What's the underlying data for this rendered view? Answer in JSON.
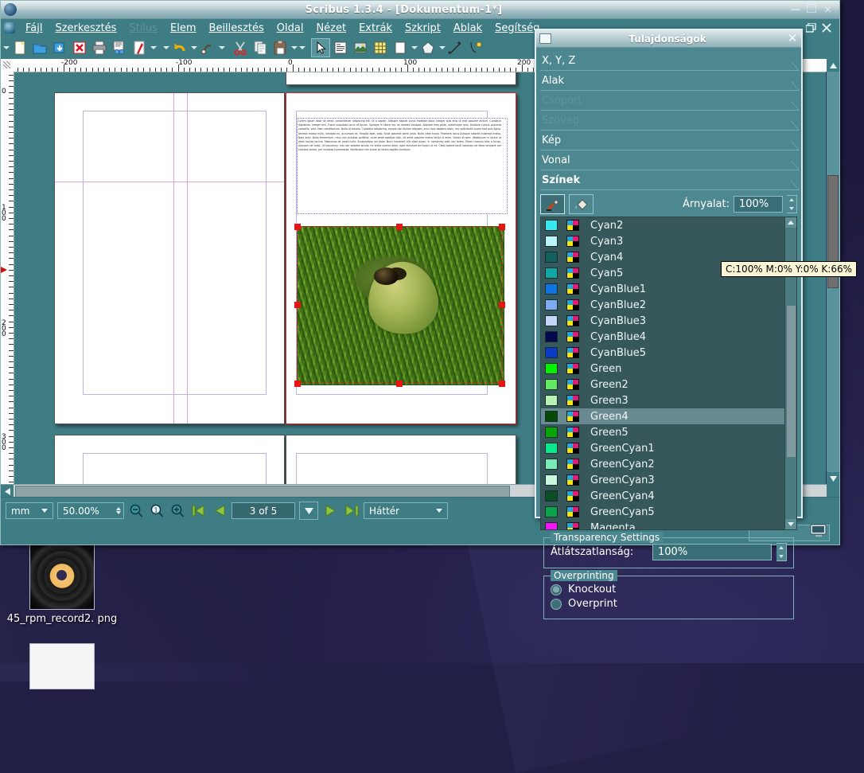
{
  "window": {
    "title": "Scribus 1.3.4 - [Dokumentum-1*]",
    "minimize": "–",
    "maximize": "□",
    "close": "×"
  },
  "menubar": {
    "items": [
      {
        "label": "Fájl",
        "accel": "F",
        "disabled": false
      },
      {
        "label": "Szerkesztés",
        "accel": "S",
        "disabled": false
      },
      {
        "label": "Stílus",
        "accel": "t",
        "disabled": true
      },
      {
        "label": "Elem",
        "accel": "E",
        "disabled": false
      },
      {
        "label": "Beillesztés",
        "accel": "B",
        "disabled": false
      },
      {
        "label": "Oldal",
        "accel": "O",
        "disabled": false
      },
      {
        "label": "Nézet",
        "accel": "N",
        "disabled": false
      },
      {
        "label": "Extrák",
        "accel": "E",
        "disabled": false
      },
      {
        "label": "Szkript",
        "accel": "k",
        "disabled": false
      },
      {
        "label": "Ablak",
        "accel": "A",
        "disabled": false
      },
      {
        "label": "Segítség",
        "accel": "S",
        "disabled": false
      }
    ]
  },
  "toolbar": {
    "buttons": [
      {
        "name": "new-document-icon"
      },
      {
        "name": "open-document-icon"
      },
      {
        "name": "save-document-icon"
      },
      {
        "name": "close-document-icon"
      },
      {
        "name": "print-icon"
      },
      {
        "name": "print-preview-icon"
      },
      {
        "name": "export-pdf-icon"
      },
      {
        "name": "undo-icon"
      },
      {
        "name": "redo-icon"
      },
      {
        "name": "cut-icon"
      },
      {
        "name": "copy-icon"
      },
      {
        "name": "paste-icon"
      },
      {
        "name": "select-item-icon"
      },
      {
        "name": "insert-text-frame-icon"
      },
      {
        "name": "insert-image-frame-icon"
      },
      {
        "name": "insert-table-icon"
      },
      {
        "name": "insert-shape-icon"
      },
      {
        "name": "insert-polygon-icon"
      },
      {
        "name": "insert-line-icon"
      },
      {
        "name": "insert-bezier-icon"
      }
    ]
  },
  "rulers": {
    "horizontal_labels": [
      "-200",
      "-100",
      "0",
      "100",
      "200"
    ],
    "vertical_labels": [
      "0",
      "100",
      "200",
      "300"
    ],
    "unit": "mm"
  },
  "canvas": {
    "text_frame_body": "Lorem ipsum dolor sit amet, consectetuer adipiscing elit. Ut a sapien. Aliquam aliquet purus molestie dolor. Integer quis eros ut erat posuere dictum. Curabitur dignissim. Integer orci. Fusce vulputate lacus at ipsum. Quisque in libero nec mi laoreet volutpat. Aliquam eros pede, scelerisque quis, tristique cursus, placerat convallis, velit. Nam conditionum. Nulla ut mauris. Curabitur adipiscing, mauris non dictum aliquam, arcu risus dapibus diam, nec sollicitudin quam erat quis ligula. Aenean massa nulla, volutpat eu, accumsan et, fringilla eget, odio. Nulla placerat porta justo. Nulla vitae turpis. Praesent lacus.Quisque lobortis euismod metus. Nam ante. Nulla fermentum, risus non pulvinar porttitor, enim pede egestas nibh, sit amet posuere metus tortor id enim. Donec at sem. Vestibulum in lectus ut diam lacinia lacinia. Maecenas sit amet nulla. Suspendisse vel dolor. Nunc hendrerit elit vitae quam. In nonummy velit nec lorem. Etiam rhoncus felis a turpis. Aliquam vel nulla. Ut nonummy, nisl non sodales iaculis, mi tellus viverra diam, eget euismod dui turpis ut mi. Class aptent taciti sociosqu ad litora torquent per conubia nostra, per inceptos hymenaeos. Vestibulum nec quam ac lectus sagittis tincidunt.",
    "image_frame_name": "frog-image"
  },
  "statusbar": {
    "unit_value": "mm",
    "zoom_value": "50.00%",
    "zoom_out_icon": "zoom-out-icon",
    "zoom_100_icon": "zoom-100-icon",
    "zoom_in_icon": "zoom-in-icon",
    "first_page_icon": "first-page-icon",
    "prev_page_icon": "previous-page-icon",
    "page_value": "3 of 5",
    "next_page_icon": "next-page-icon",
    "last_page_icon": "last-page-icon",
    "layer_value": "Háttér"
  },
  "properties": {
    "title": "Tulajdonságok",
    "close": "✕",
    "sections": [
      {
        "label": "X, Y, Z",
        "accel": "Z",
        "disabled": false,
        "current": false
      },
      {
        "label": "Alak",
        "accel": "A",
        "disabled": false,
        "current": false
      },
      {
        "label": "Csoport",
        "accel": "C",
        "disabled": true,
        "current": false
      },
      {
        "label": "Szöveg",
        "accel": "S",
        "disabled": true,
        "current": false
      },
      {
        "label": "Kép",
        "accel": "K",
        "disabled": false,
        "current": false
      },
      {
        "label": "Vonal",
        "accel": "V",
        "disabled": false,
        "current": false
      },
      {
        "label": "Színek",
        "accel": "",
        "disabled": false,
        "current": true
      }
    ],
    "stroke_button": "stroke-color-icon",
    "fill_button": "fill-color-icon",
    "tint_label": "Árnyalat:",
    "tint_value": "100%",
    "colors": [
      {
        "name": "Cyan2",
        "hex": "#35e9ee"
      },
      {
        "name": "Cyan3",
        "hex": "#baf5f9"
      },
      {
        "name": "Cyan4",
        "hex": "#13615f"
      },
      {
        "name": "Cyan5",
        "hex": "#10a7a4"
      },
      {
        "name": "CyanBlue1",
        "hex": "#0e74e2"
      },
      {
        "name": "CyanBlue2",
        "hex": "#7cabf0"
      },
      {
        "name": "CyanBlue3",
        "hex": "#c3d7f7"
      },
      {
        "name": "CyanBlue4",
        "hex": "#04084f"
      },
      {
        "name": "CyanBlue5",
        "hex": "#0b3bc4"
      },
      {
        "name": "Green",
        "hex": "#00f200"
      },
      {
        "name": "Green2",
        "hex": "#62e862"
      },
      {
        "name": "Green3",
        "hex": "#b6f2b6"
      },
      {
        "name": "Green4",
        "hex": "#074a07"
      },
      {
        "name": "Green5",
        "hex": "#08a508"
      },
      {
        "name": "GreenCyan1",
        "hex": "#07e98c"
      },
      {
        "name": "GreenCyan2",
        "hex": "#78ecb7"
      },
      {
        "name": "GreenCyan3",
        "hex": "#c9f7e2"
      },
      {
        "name": "GreenCyan4",
        "hex": "#0b4d26"
      },
      {
        "name": "GreenCyan5",
        "hex": "#0aa347"
      },
      {
        "name": "Magenta",
        "hex": "#f715f7"
      }
    ],
    "selected_color": "Green4",
    "transparency": {
      "group_label": "Transparency Settings",
      "opacity_label": "Átlátszatlanság:",
      "opacity_value": "100%"
    },
    "overprinting": {
      "group_label": "Overprinting",
      "options": [
        {
          "label": "Knockout",
          "selected": true
        },
        {
          "label": "Overprint",
          "selected": false
        }
      ]
    }
  },
  "tooltip": {
    "text": "C:100% M:0% Y:0% K:66%"
  },
  "desktop": {
    "icons": [
      {
        "label": "45_rpm_record2.\npng",
        "name": "file-45-rpm-record2-png"
      }
    ]
  }
}
